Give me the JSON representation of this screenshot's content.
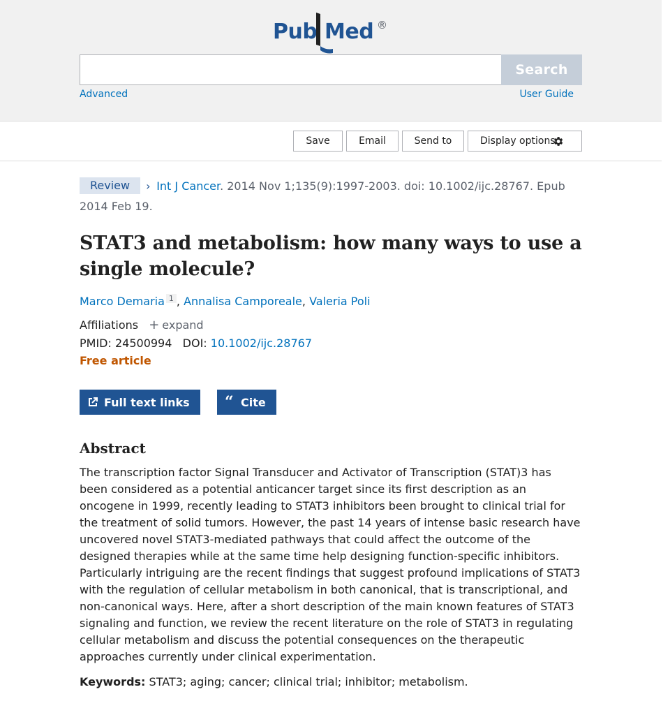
{
  "logo": {
    "part1": "Pub",
    "part2": "Med",
    "reg": "®"
  },
  "search": {
    "placeholder": "",
    "button": "Search",
    "advanced": "Advanced",
    "user_guide": "User Guide"
  },
  "toolbar": {
    "save": "Save",
    "email": "Email",
    "send_to": "Send to",
    "display_options": "Display options"
  },
  "article": {
    "type_badge": "Review",
    "journal": "Int J Cancer",
    "citation": ". 2014 Nov 1;135(9):1997-2003. doi: 10.1002/ijc.28767. Epub 2014 Feb 19.",
    "title": "STAT3 and metabolism: how many ways to use a single molecule?",
    "authors": [
      {
        "name": "Marco Demaria",
        "sup": "1"
      },
      {
        "name": "Annalisa Camporeale"
      },
      {
        "name": "Valeria Poli"
      }
    ],
    "affiliations_label": "Affiliations",
    "expand_label": "expand",
    "pmid_label": "PMID: 24500994",
    "doi_label": "DOI: ",
    "doi_value": "10.1002/ijc.28767",
    "free_label": "Free article",
    "full_text_button": "Full text links",
    "cite_button": "Cite",
    "abstract_heading": "Abstract",
    "abstract": "The transcription factor Signal Transducer and Activator of Transcription (STAT)3 has been considered as a potential anticancer target since its first description as an oncogene in 1999, recently leading to STAT3 inhibitors been brought to clinical trial for the treatment of solid tumors. However, the past 14 years of intense basic research have uncovered novel STAT3-mediated pathways that could affect the outcome of the designed therapies while at the same time help designing function-specific inhibitors. Particularly intriguing are the recent findings that suggest profound implications of STAT3 with the regulation of cellular metabolism in both canonical, that is transcriptional, and non-canonical ways. Here, after a short description of the main known features of STAT3 signaling and function, we review the recent literature on the role of STAT3 in regulating cellular metabolism and discuss the potential consequences on the therapeutic approaches currently under clinical experimentation.",
    "keywords_label": "Keywords:",
    "keywords": "STAT3; aging; cancer; clinical trial; inhibitor; metabolism."
  },
  "colors": {
    "brand": "#205493",
    "link": "#0071bc",
    "free": "#c05600",
    "badge_bg": "#dce4ef"
  },
  "icons": [
    "pubmed-logo",
    "gear-icon",
    "chevron-right-icon",
    "plus-icon",
    "external-link-icon",
    "quote-icon"
  ]
}
